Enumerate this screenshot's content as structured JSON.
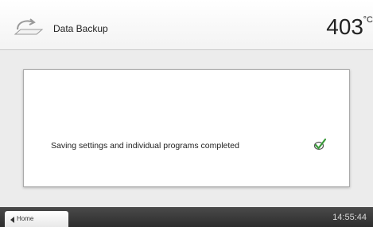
{
  "header": {
    "icon": "backup-icon",
    "title": "Data Backup",
    "temperature": "403",
    "unit": "°C"
  },
  "main": {
    "message": "Saving settings and individual programs completed",
    "status_icon": "checkmark-icon",
    "status_color": "#3a9a3a"
  },
  "footer": {
    "home_label": "Home",
    "home_icon": "left-arrow-icon",
    "time": "14:55:44"
  }
}
